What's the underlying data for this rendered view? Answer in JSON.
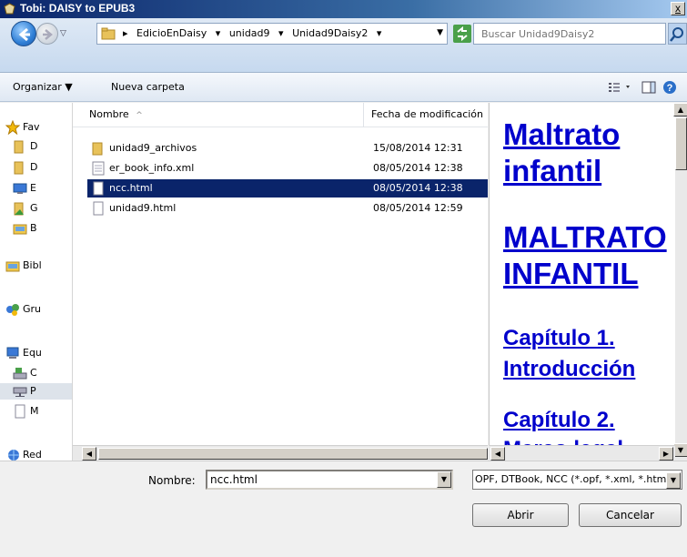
{
  "window": {
    "title": "Tobi: DAISY to EPUB3",
    "close_label": "x"
  },
  "address": {
    "crumbs": [
      "EdicioEnDaisy",
      "unidad9",
      "Unidad9Daisy2"
    ],
    "search_placeholder": "Buscar Unidad9Daisy2"
  },
  "toolbar": {
    "organize_label": "Organizar ▼",
    "new_folder_label": "Nueva carpeta"
  },
  "nav": {
    "items": [
      {
        "label": "Fav",
        "icon": "star-icon"
      },
      {
        "label": "D",
        "icon": "folder-icon"
      },
      {
        "label": "D",
        "icon": "folder-icon"
      },
      {
        "label": "E",
        "icon": "desktop-icon"
      },
      {
        "label": "G",
        "icon": "folder-icon"
      },
      {
        "label": "B",
        "icon": "library-icon"
      },
      {
        "label": "Bibl",
        "icon": "library-icon"
      },
      {
        "label": "Gru",
        "icon": "homegroup-icon"
      },
      {
        "label": "Equ",
        "icon": "computer-icon"
      },
      {
        "label": "C",
        "icon": "drive-icon"
      },
      {
        "label": "P",
        "icon": "network-drive-icon"
      },
      {
        "label": "M",
        "icon": "file-icon"
      },
      {
        "label": "Red",
        "icon": "network-icon"
      }
    ]
  },
  "filelist": {
    "columns": {
      "name": "Nombre",
      "date": "Fecha de modificación"
    },
    "rows": [
      {
        "name": "unidad9_archivos",
        "date": "15/08/2014 12:31",
        "type": "folder"
      },
      {
        "name": "er_book_info.xml",
        "date": "08/05/2014 12:38",
        "type": "xml"
      },
      {
        "name": "ncc.html",
        "date": "08/05/2014 12:38",
        "type": "file",
        "selected": true
      },
      {
        "name": "unidad9.html",
        "date": "08/05/2014 12:59",
        "type": "file"
      }
    ]
  },
  "preview": {
    "title1": "Maltrato",
    "title2": "infantil",
    "heading1": "MALTRATO",
    "heading2": "INFANTIL",
    "ch1a": "Capítulo 1.",
    "ch1b": "Introducción",
    "ch2a": "Capítulo 2.",
    "ch2b": "Marco legal"
  },
  "bottom": {
    "name_label": "Nombre:",
    "name_value": "ncc.html",
    "filter_value": "OPF, DTBook, NCC (*.opf, *.xml, *.html)",
    "open_label": "Abrir",
    "cancel_label": "Cancelar"
  },
  "colors": {
    "selection": "#0a246a",
    "link": "#0000cc"
  }
}
